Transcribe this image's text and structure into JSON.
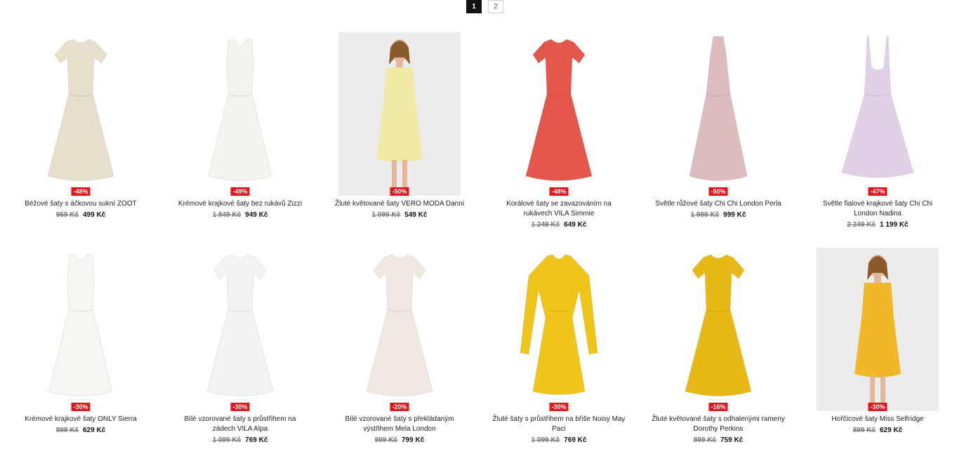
{
  "pagination": {
    "pages": [
      "1",
      "2"
    ],
    "active": "1"
  },
  "colors": {
    "discount_badge": "#e0161b",
    "active_page": "#111111"
  },
  "products": [
    {
      "name": "Béžové šaty s áčkovou sukní ZOOT",
      "discount": "-48%",
      "old_price": "959 Kč",
      "new_price": "499 Kč",
      "image": "dress-beige",
      "dress_color": "#e6dfcc",
      "style": "sleeve"
    },
    {
      "name": "Krémové krajkové šaty bez rukávů Zizzi",
      "discount": "-49%",
      "old_price": "1 849 Kč",
      "new_price": "949 Kč",
      "image": "dress-cream-lace",
      "dress_color": "#f4f3ee",
      "style": "tank"
    },
    {
      "name": "Žluté květované šaty VERO MODA Danni",
      "discount": "-50%",
      "old_price": "1 099 Kč",
      "new_price": "549 Kč",
      "image": "model-yellow-floral-dress",
      "dress_color": "#f0eaa6",
      "style": "model"
    },
    {
      "name": "Korálové šaty se zavazováním na rukávech VILA Simmie",
      "discount": "-48%",
      "old_price": "1 249 Kč",
      "new_price": "649 Kč",
      "image": "dress-coral",
      "dress_color": "#e5574a",
      "style": "sleeve"
    },
    {
      "name": "Světle růžové šaty Chi Chi London Perla",
      "discount": "-50%",
      "old_price": "1 999 Kč",
      "new_price": "999 Kč",
      "image": "dress-light-pink",
      "dress_color": "#dcbcbc",
      "style": "halter"
    },
    {
      "name": "Světle fialové krajkové šaty Chi Chi London Nadina",
      "discount": "-47%",
      "old_price": "2 249 Kč",
      "new_price": "1 199 Kč",
      "image": "dress-lilac-lace",
      "dress_color": "#e2d0e6",
      "style": "strappy"
    },
    {
      "name": "Krémové krajkové šaty ONLY Sierra",
      "discount": "-30%",
      "old_price": "899 Kč",
      "new_price": "629 Kč",
      "image": "dress-cream-wrap",
      "dress_color": "#f6f6f3",
      "style": "tank"
    },
    {
      "name": "Bílé vzorované šaty s průstřihem na zádech VILA Alpa",
      "discount": "-30%",
      "old_price": "1 099 Kč",
      "new_price": "769 Kč",
      "image": "dress-white-pattern",
      "dress_color": "#f3f3f1",
      "style": "sleeve"
    },
    {
      "name": "Bílé vzorované šaty s překládaným výstřihem Mela London",
      "discount": "-20%",
      "old_price": "999 Kč",
      "new_price": "799 Kč",
      "image": "dress-butterfly-print",
      "dress_color": "#efe9e2",
      "style": "sleeve"
    },
    {
      "name": "Žluté šaty s průstřihem na břiše Noisy May Paci",
      "discount": "-30%",
      "old_price": "1 099 Kč",
      "new_price": "769 Kč",
      "image": "dress-yellow-longsleeve",
      "dress_color": "#f0c51a",
      "style": "long"
    },
    {
      "name": "Žluté květované šaty s odhalenými rameny Dorothy Perkins",
      "discount": "-16%",
      "old_price": "899 Kč",
      "new_price": "759 Kč",
      "image": "dress-yellow-floral",
      "dress_color": "#e8b916",
      "style": "sleeve"
    },
    {
      "name": "Hořčicové šaty Miss Selfridge",
      "discount": "-30%",
      "old_price": "899 Kč",
      "new_price": "629 Kč",
      "image": "model-mustard-dress",
      "dress_color": "#f0b728",
      "style": "model"
    }
  ]
}
